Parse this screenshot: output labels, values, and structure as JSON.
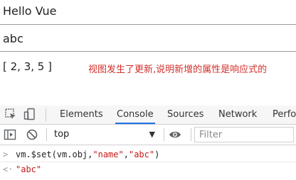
{
  "page": {
    "title": "Hello Vue",
    "input_value": "abc",
    "array_display": "[ 2, 3, 5 ]",
    "note": "视图发生了更新,说明新增的属性是响应式的",
    "note_color": "#d0312d"
  },
  "devtools": {
    "tabs": [
      "Elements",
      "Console",
      "Sources",
      "Network",
      "Perfor"
    ],
    "active_tab": "Console",
    "accent": "#1a73e8",
    "context": "top",
    "filter_placeholder": "Filter",
    "console": {
      "command": {
        "prefix": "vm.$set(vm.obj,",
        "arg1": "\"name\"",
        "sep": ",",
        "arg2": "\"abc\"",
        "suffix": ")"
      },
      "result": "\"abc\""
    },
    "icons": [
      "inspect-icon",
      "device-toggle-icon",
      "sidebar-toggle-icon",
      "clear-console-icon",
      "eye-icon",
      "chevron-down-icon"
    ]
  }
}
